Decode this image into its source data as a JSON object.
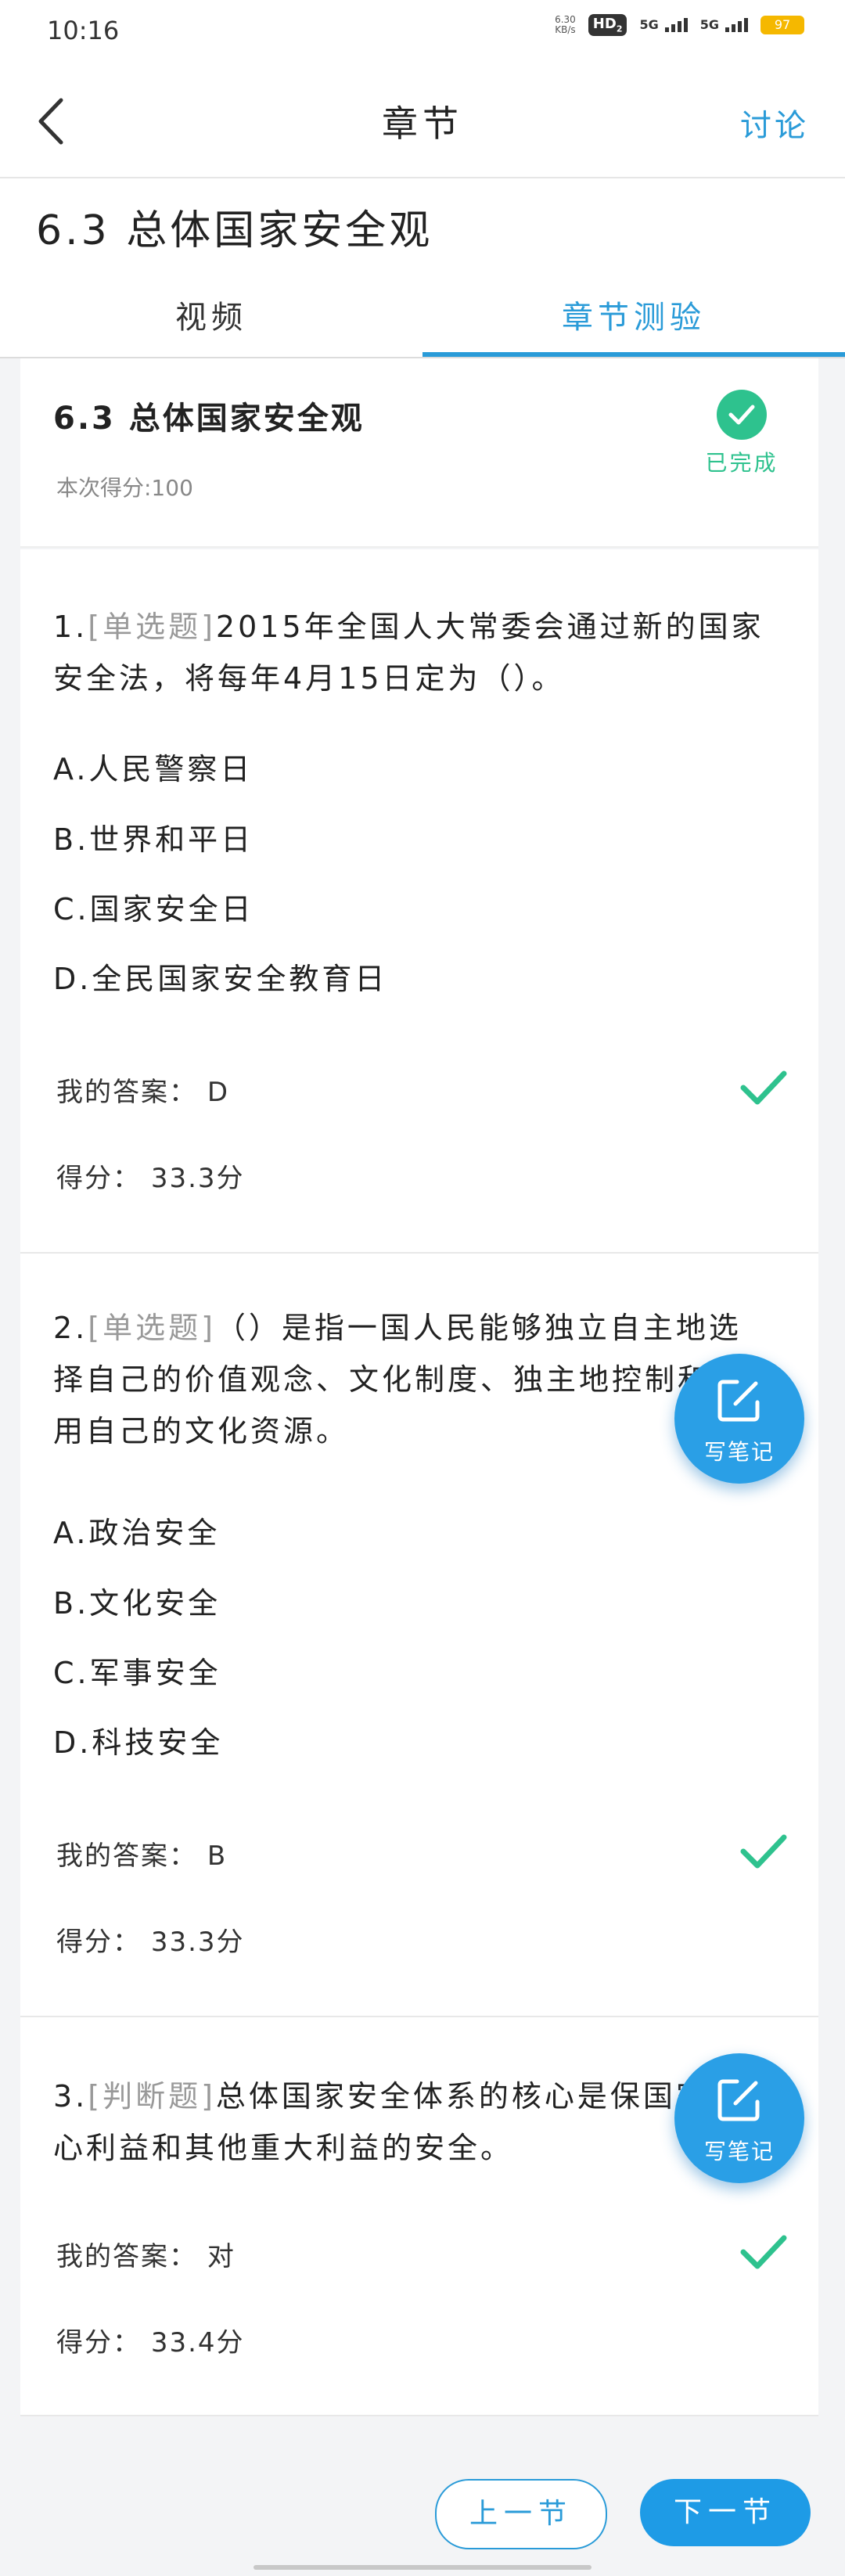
{
  "status": {
    "time": "10:16",
    "net_speed_value": "6.30",
    "net_speed_unit": "KB/s",
    "hd": "HD",
    "hd_sub": "2",
    "sig1": "5G",
    "sig2": "5G",
    "battery": "97"
  },
  "header": {
    "title": "章节",
    "discuss": "讨论"
  },
  "page": {
    "chapter_title": "6.3 总体国家安全观"
  },
  "tabs": [
    {
      "label": "视频"
    },
    {
      "label": "章节测验"
    }
  ],
  "summary": {
    "title": "6.3 总体国家安全观",
    "score": "本次得分:100",
    "status": "已完成",
    "status_color": "#2ec28e"
  },
  "questions": [
    {
      "num": "1.",
      "type": "[单选题]",
      "text": "2015年全国人大常委会通过新的国家安全法，将每年4月15日定为（）。",
      "options": [
        "A.人民警察日",
        "B.世界和平日",
        "C.国家安全日",
        "D.全民国家安全教育日"
      ],
      "answer_label": "我的答案：",
      "answer": "D",
      "score_label": "得分：",
      "score": "33.3分"
    },
    {
      "num": "2.",
      "type": "[单选题]",
      "text": "（）是指一国人民能够独立自主地选择自己的价值观念、文化制度、独主地控制和利用自己的文化资源。",
      "options": [
        "A.政治安全",
        "B.文化安全",
        "C.军事安全",
        "D.科技安全"
      ],
      "answer_label": "我的答案：",
      "answer": "B",
      "score_label": "得分：",
      "score": "33.3分"
    },
    {
      "num": "3.",
      "type": "[判断题]",
      "text": "总体国家安全体系的核心是保国家核心利益和其他重大利益的安全。",
      "options": [],
      "answer_label": "我的答案：",
      "answer": "对",
      "score_label": "得分：",
      "score": "33.4分"
    }
  ],
  "fab": {
    "label": "写笔记",
    "icon": "edit-note-icon"
  },
  "footer": {
    "prev": "上一节",
    "next": "下一节"
  },
  "colors": {
    "accent": "#2a9bd8",
    "success": "#2ec28e"
  }
}
